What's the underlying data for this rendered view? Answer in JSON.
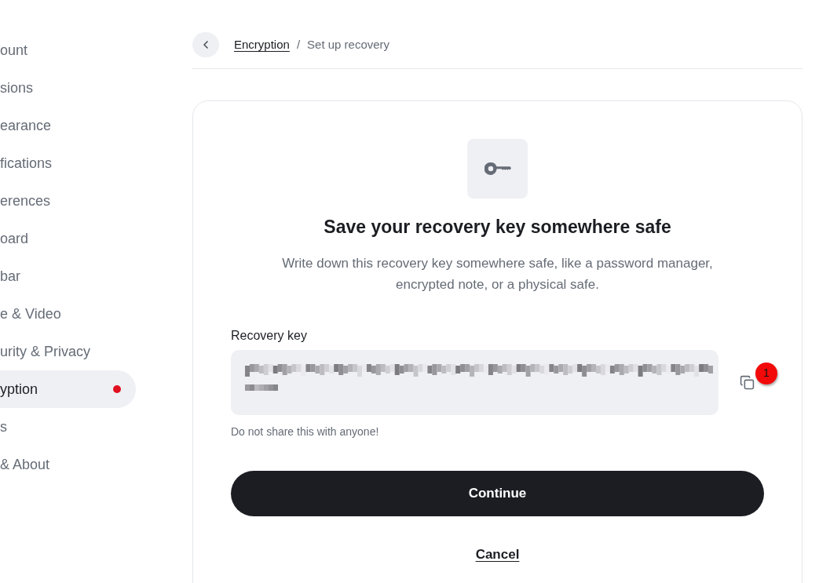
{
  "sidebar": {
    "items": [
      {
        "label": "ount",
        "selected": false,
        "alert": false
      },
      {
        "label": "sions",
        "selected": false,
        "alert": false
      },
      {
        "label": "earance",
        "selected": false,
        "alert": false
      },
      {
        "label": "fications",
        "selected": false,
        "alert": false
      },
      {
        "label": "erences",
        "selected": false,
        "alert": false
      },
      {
        "label": "oard",
        "selected": false,
        "alert": false
      },
      {
        "label": "bar",
        "selected": false,
        "alert": false
      },
      {
        "label": "e & Video",
        "selected": false,
        "alert": false
      },
      {
        "label": "urity & Privacy",
        "selected": false,
        "alert": false
      },
      {
        "label": "yption",
        "selected": true,
        "alert": true
      },
      {
        "label": "s",
        "selected": false,
        "alert": false
      },
      {
        "label": "& About",
        "selected": false,
        "alert": false
      }
    ]
  },
  "header": {
    "breadcrumb": [
      {
        "label": "Encryption",
        "kind": "link"
      },
      {
        "label": "Set up recovery",
        "kind": "current"
      }
    ],
    "separator": "/"
  },
  "card": {
    "title": "Save your recovery key somewhere safe",
    "description": "Write down this recovery key somewhere safe, like a password manager, encrypted note, or a physical safe.",
    "field": {
      "label": "Recovery key",
      "hint": "Do not share this with anyone!"
    },
    "copy_badge": "1",
    "buttons": [
      {
        "label": "Continue",
        "kind": "primary"
      },
      {
        "label": "Cancel",
        "kind": "link"
      }
    ]
  }
}
